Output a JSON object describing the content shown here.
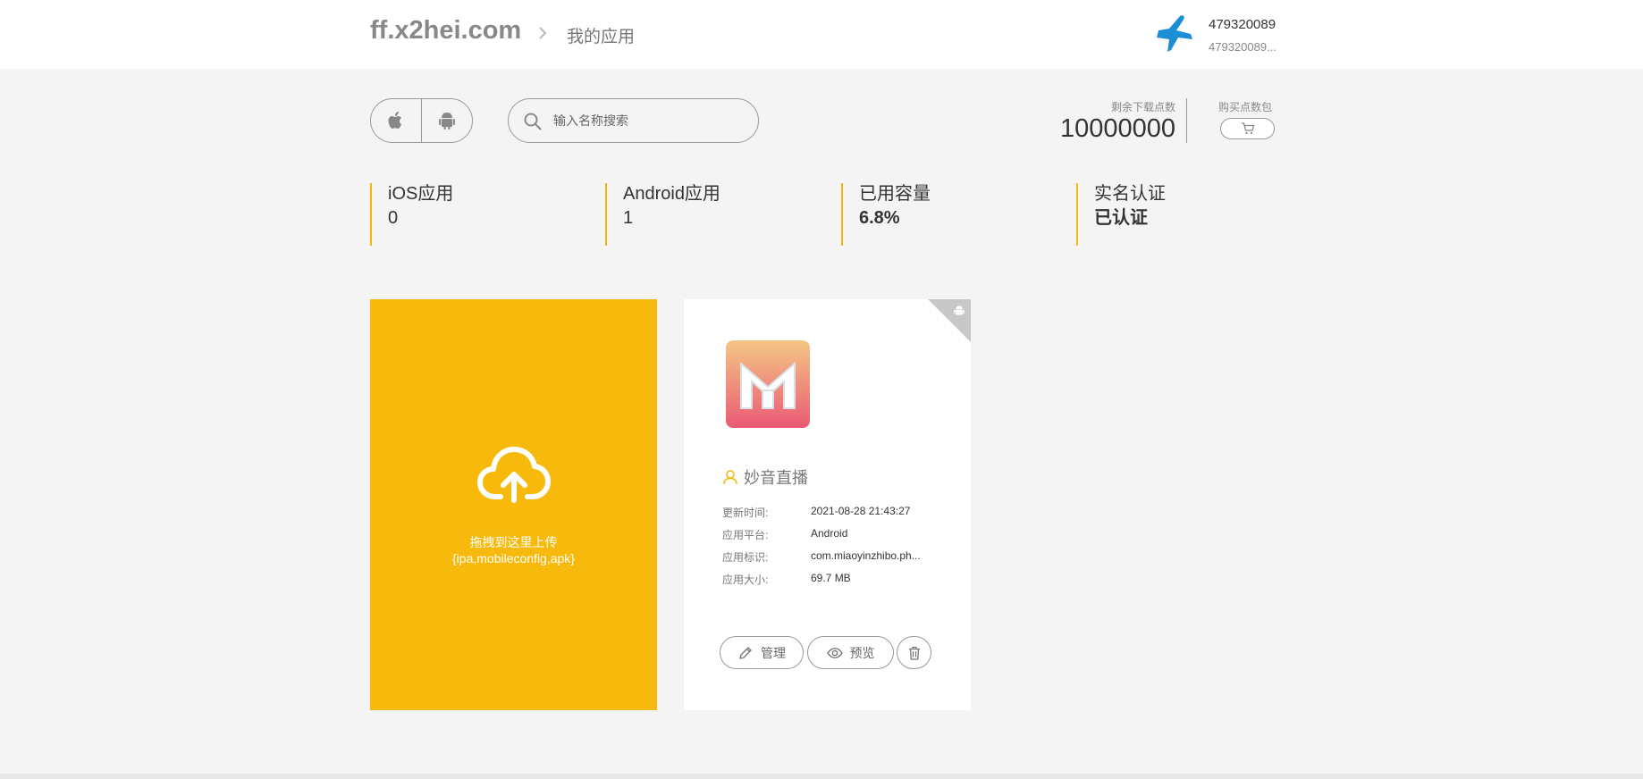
{
  "header": {
    "brand": "ff.x2hei.com",
    "crumb": "我的应用",
    "user_name": "479320089",
    "user_sub": "479320089..."
  },
  "toolbar": {
    "search_placeholder": "输入名称搜索",
    "points_label": "剩余下载点数",
    "points_value": "10000000",
    "buy_label": "购买点数包"
  },
  "stats": [
    {
      "label": "iOS应用",
      "value": "0"
    },
    {
      "label": "Android应用",
      "value": "1"
    },
    {
      "label": "已用容量",
      "value": "6.8%"
    },
    {
      "label": "实名认证",
      "value": "已认证"
    }
  ],
  "upload": {
    "line1": "拖拽到这里上传",
    "line2": "{ipa,mobileconfig,apk}"
  },
  "app": {
    "name": "妙音直播",
    "meta": [
      {
        "key": "更新时间:",
        "value": "2021-08-28 21:43:27"
      },
      {
        "key": "应用平台:",
        "value": "Android"
      },
      {
        "key": "应用标识:",
        "value": "com.miaoyinzhibo.ph..."
      },
      {
        "key": "应用大小:",
        "value": "69.7 MB"
      }
    ],
    "manage_label": "管理",
    "preview_label": "预览"
  },
  "colors": {
    "accent": "#f7b90b",
    "brand_blue": "#1b8ed6",
    "app_icon_top": "#f4c784",
    "app_icon_bottom": "#ea5a74"
  },
  "icons": {
    "platform_ios": "apple-icon",
    "platform_android": "android-icon",
    "search": "search-icon",
    "cart": "cart-icon",
    "upload": "cloud-upload-icon",
    "user": "user-icon",
    "manage": "pencil-icon",
    "preview": "eye-icon",
    "delete": "trash-icon"
  }
}
